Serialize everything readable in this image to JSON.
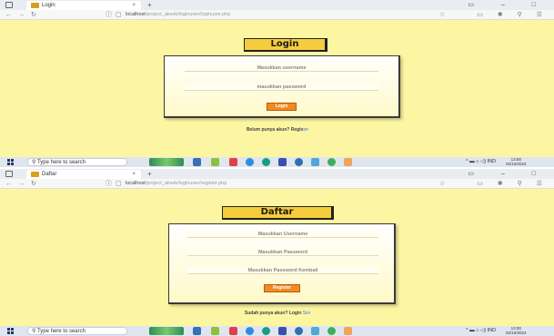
{
  "login_screen": {
    "tab_title": "Login",
    "tab_close": "×",
    "new_tab": "+",
    "window_controls": "▭ – □",
    "nav": {
      "back": "←",
      "forward": "→",
      "reload": "↻"
    },
    "url_host": "localhost",
    "url_path": "/project_aksek/loginuser/loginuser.php",
    "page": {
      "title": "Login",
      "username_placeholder": "Masukkan username",
      "password_placeholder": "masukkan password",
      "submit_label": "Login",
      "footer_text": "Belum punya akun? Regis",
      "footer_link": "ter"
    },
    "taskbar": {
      "search_placeholder": "Type here to search",
      "tray_text": "^ ▬ ⌂ ◁) IND",
      "clock_time": "13:00",
      "clock_date": "02/10/2024"
    }
  },
  "register_screen": {
    "tab_title": "Daftar",
    "tab_close": "×",
    "new_tab": "+",
    "window_controls": "▭ – □",
    "nav": {
      "back": "←",
      "forward": "→",
      "reload": "↻"
    },
    "url_host": "localhost",
    "url_path": "/project_aksek/loginuser/register.php",
    "page": {
      "title": "Daftar",
      "username_placeholder": "Masukkan Username",
      "password_placeholder": "Masukkan Password",
      "confirm_placeholder": "Masukkan Password Kembali",
      "submit_label": "Register",
      "footer_text": "Sudah punya akun? Login ",
      "footer_link": "Sini"
    },
    "taskbar": {
      "search_placeholder": "Type here to search",
      "tray_text": "^ ▬ ⌂ ◁) IND",
      "clock_time": "13:00",
      "clock_date": "02/10/2024"
    }
  },
  "colors": {
    "page_background": "#fcf6a2",
    "title_box": "#f5cc3c",
    "button": "#f08a22",
    "link": "#4b79d6"
  },
  "icons": {
    "tab_favicon": "xampp-favicon-icon",
    "home": "home-icon",
    "star": "star-icon",
    "extensions": "puzzle-icon"
  }
}
